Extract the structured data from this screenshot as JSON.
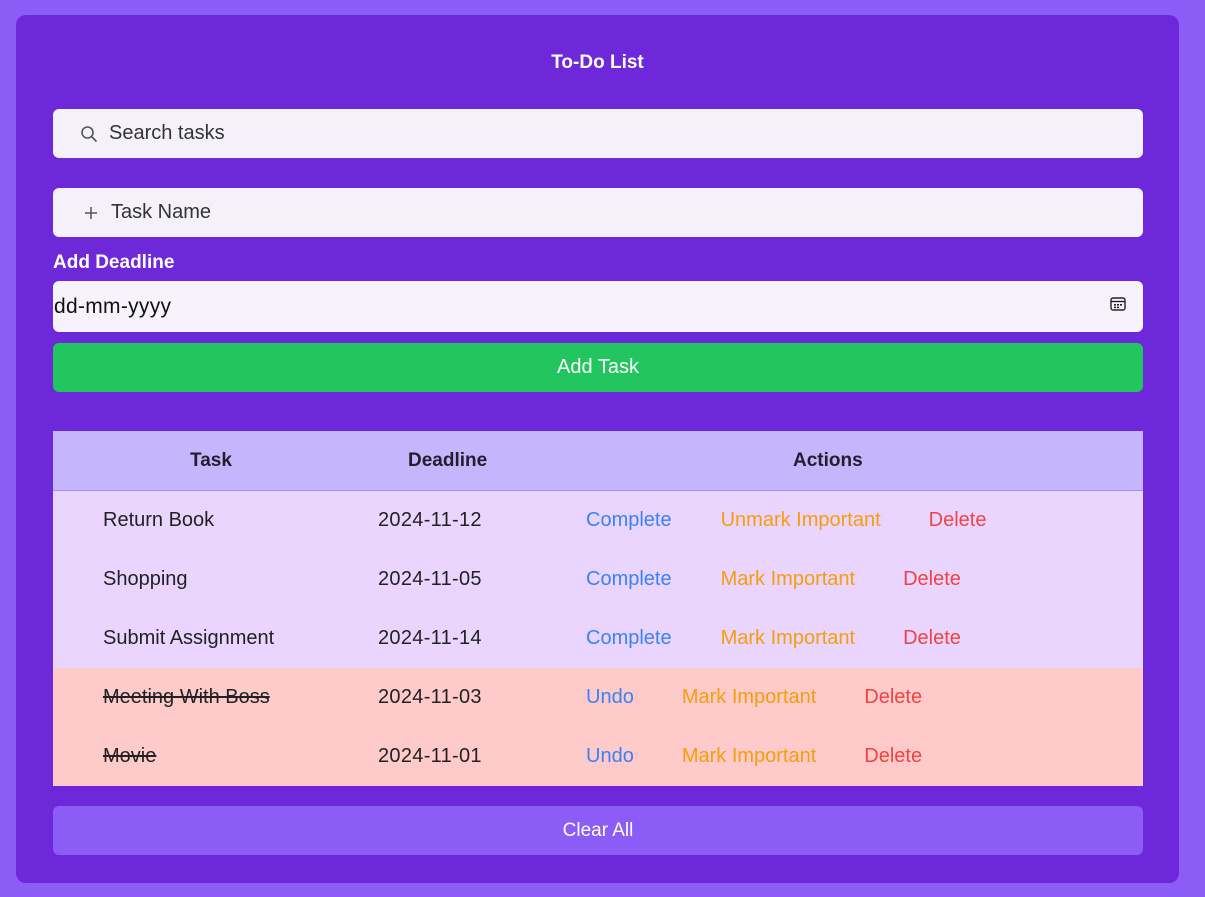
{
  "app": {
    "title": "To-Do List"
  },
  "search": {
    "placeholder": "Search tasks",
    "icon": "search-icon"
  },
  "new_task": {
    "placeholder": "Task Name",
    "icon": "plus-icon"
  },
  "deadline": {
    "label": "Add Deadline",
    "placeholder": "dd-mm-yyyy",
    "icon": "calendar-icon"
  },
  "buttons": {
    "add": "Add Task",
    "clear": "Clear All"
  },
  "table": {
    "headers": {
      "task": "Task",
      "deadline": "Deadline",
      "actions": "Actions"
    },
    "rows": [
      {
        "task": "Return Book",
        "deadline": "2024-11-12",
        "status": "pending",
        "complete": "Complete",
        "important": "Unmark Important",
        "delete": "Delete"
      },
      {
        "task": "Shopping",
        "deadline": "2024-11-05",
        "status": "pending",
        "complete": "Complete",
        "important": "Mark Important",
        "delete": "Delete"
      },
      {
        "task": "Submit Assignment",
        "deadline": "2024-11-14",
        "status": "pending",
        "complete": "Complete",
        "important": "Mark Important",
        "delete": "Delete"
      },
      {
        "task": "Meeting With Boss",
        "deadline": "2024-11-03",
        "status": "done",
        "complete": "Undo",
        "important": "Mark Important",
        "delete": "Delete"
      },
      {
        "task": "Movie",
        "deadline": "2024-11-01",
        "status": "done",
        "complete": "Undo",
        "important": "Mark Important",
        "delete": "Delete"
      }
    ]
  },
  "colors": {
    "page_bg": "#8b5cf6",
    "card_bg": "#6d28d9",
    "add_button": "#22c55e",
    "header_row": "#c4b5fd",
    "pending_row": "#e9d5ff",
    "done_row": "#fecaca",
    "complete_action": "#3b82f6",
    "important_action": "#f59e0b",
    "delete_action": "#ef4444"
  }
}
